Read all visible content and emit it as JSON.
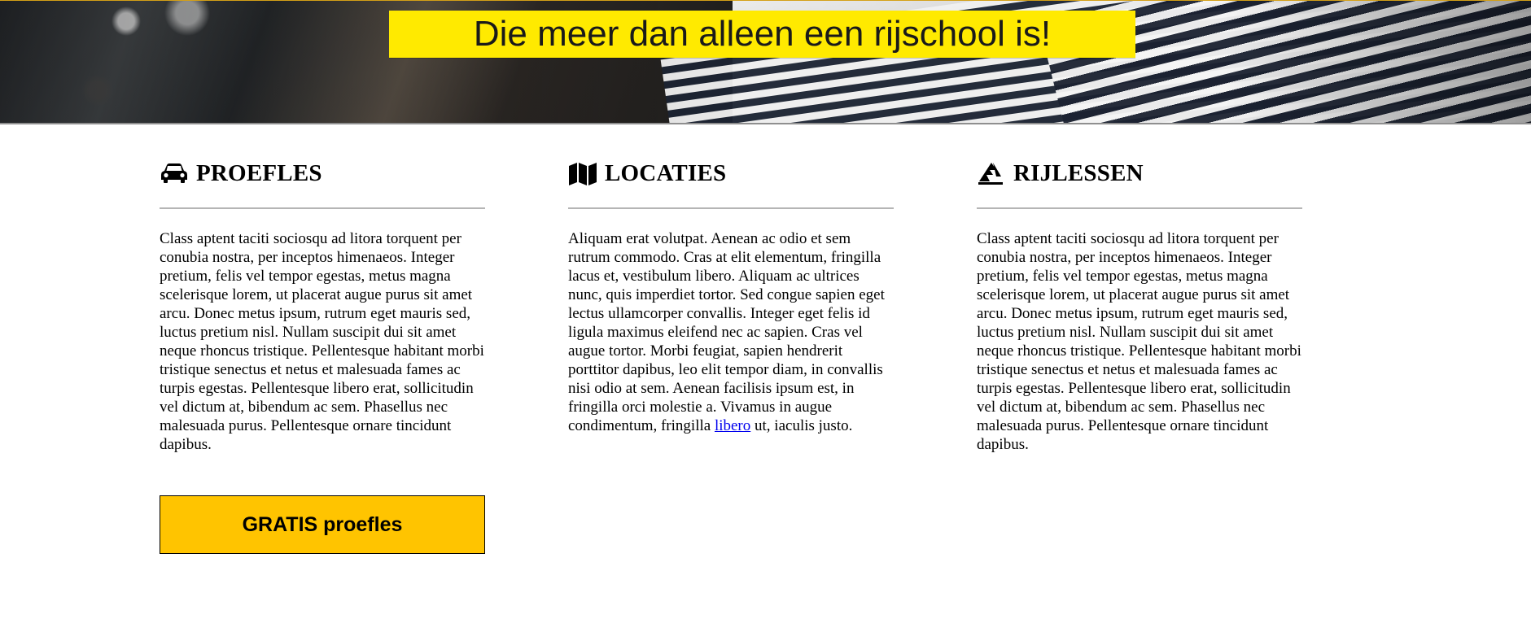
{
  "hero": {
    "banner_text": "Die meer dan alleen een rijschool is!"
  },
  "colors": {
    "banner_bg": "#ffea00",
    "button_bg": "#ffc400",
    "link": "#0000ee",
    "rule": "#b5b5b5"
  },
  "columns": [
    {
      "icon": "car-icon",
      "title": "PROEFLES",
      "text": "Class aptent taciti sociosqu ad litora torquent per conubia nostra, per inceptos himenaeos. Integer pretium, felis vel tempor egestas, metus magna scelerisque lorem, ut placerat augue purus sit amet arcu. Donec metus ipsum, rutrum eget mauris sed, luctus pretium nisl. Nullam suscipit dui sit amet neque rhoncus tristique. Pellentesque habitant morbi tristique senectus et netus et malesuada fames ac turpis egestas. Pellentesque libero erat, sollicitudin vel dictum at, bibendum ac sem. Phasellus nec malesuada purus. Pellentesque ornare tincidunt dapibus.",
      "button_label": "GRATIS proefles"
    },
    {
      "icon": "map-icon",
      "title": "LOCATIES",
      "text_before_link": "Aliquam erat volutpat. Aenean ac odio et sem rutrum commodo. Cras at elit elementum, fringilla lacus et, vestibulum libero. Aliquam ac ultrices nunc, quis imperdiet tortor. Sed congue sapien eget lectus ullamcorper convallis. Integer eget felis id ligula maximus eleifend nec ac sapien. Cras vel augue tortor. Morbi feugiat, sapien hendrerit porttitor dapibus, leo elit tempor diam, in convallis nisi odio at sem. Aenean facilisis ipsum est, in fringilla orci molestie a. Vivamus in augue condimentum, fringilla ",
      "link_text": "libero",
      "text_after_link": " ut, iaculis justo."
    },
    {
      "icon": "road-sign-icon",
      "title": "RIJLESSEN",
      "text": "Class aptent taciti sociosqu ad litora torquent per conubia nostra, per inceptos himenaeos. Integer pretium, felis vel tempor egestas, metus magna scelerisque lorem, ut placerat augue purus sit amet arcu. Donec metus ipsum, rutrum eget mauris sed, luctus pretium nisl. Nullam suscipit dui sit amet neque rhoncus tristique. Pellentesque habitant morbi tristique senectus et netus et malesuada fames ac turpis egestas. Pellentesque libero erat, sollicitudin vel dictum at, bibendum ac sem. Phasellus nec malesuada purus. Pellentesque ornare tincidunt dapibus."
    }
  ]
}
